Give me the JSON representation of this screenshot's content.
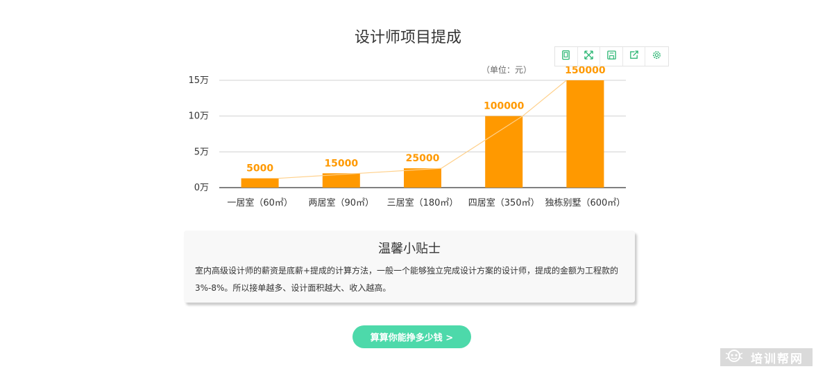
{
  "page": {
    "title": "设计师项目提成"
  },
  "toolbox": {
    "items": [
      "data-view-icon",
      "zoom-icon",
      "save-image-icon",
      "share-icon",
      "settings-icon"
    ],
    "color": "#2bb673"
  },
  "chart_data": {
    "type": "bar",
    "unit_label": "（单位：元）",
    "categories": [
      "一居室（60㎡）",
      "两居室（90㎡）",
      "三居室（180㎡）",
      "四居室（350㎡）",
      "独栋别墅（600㎡）"
    ],
    "values": [
      5000,
      15000,
      25000,
      100000,
      150000
    ],
    "data_labels": [
      "5000",
      "15000",
      "25000",
      "100000",
      "150000"
    ],
    "bar_visual_values": [
      13000,
      20000,
      27000,
      100000,
      150000
    ],
    "yticks": [
      0,
      50000,
      100000,
      150000
    ],
    "ytick_labels": [
      "0万",
      "5万",
      "10万",
      "15万"
    ],
    "ylim": [
      0,
      150000
    ],
    "grid": true,
    "trend_line": true,
    "bar_color": "#ff9900",
    "label_color": "#ff9900",
    "line_color": "#ffd08a"
  },
  "tip": {
    "title": "温馨小贴士",
    "line1": "室内高级设计师的薪资是底薪+提成的计算方法，一般一个能够独立完成设计方案的设计师，提成的金额为工程款的",
    "line2": "3%-8%。所以接单越多、设计面积越大、收入越高。"
  },
  "cta": {
    "label": "算算你能挣多少钱 >"
  },
  "watermark": {
    "text": "培训帮网"
  }
}
